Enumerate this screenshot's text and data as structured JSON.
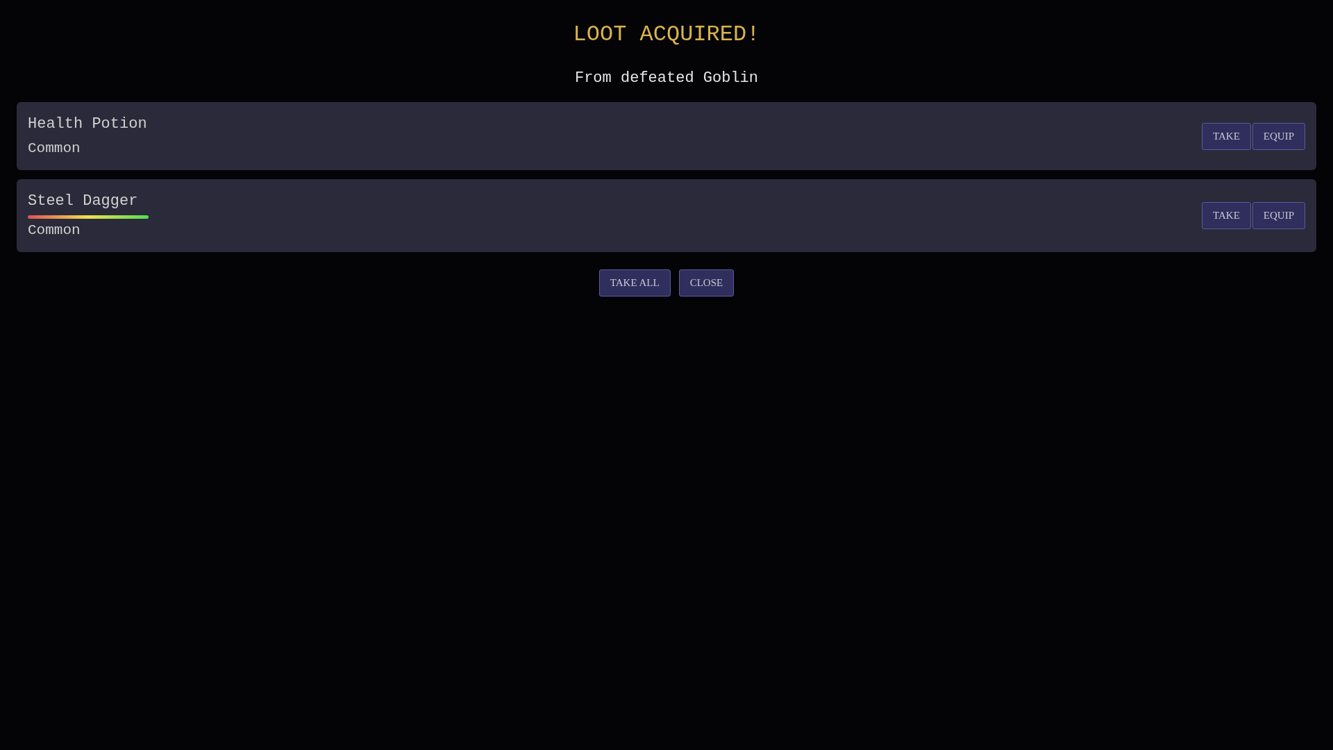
{
  "title": "LOOT ACQUIRED!",
  "subtitle": "From defeated Goblin",
  "items": [
    {
      "name": "Health Potion",
      "rarity": "Common",
      "show_bar": false,
      "buttons": [
        "TAKE",
        "EQUIP"
      ]
    },
    {
      "name": "Steel Dagger",
      "rarity": "Common",
      "show_bar": true,
      "buttons": [
        "TAKE",
        "EQUIP"
      ]
    }
  ],
  "actions": [
    "TAKE ALL",
    "CLOSE"
  ]
}
